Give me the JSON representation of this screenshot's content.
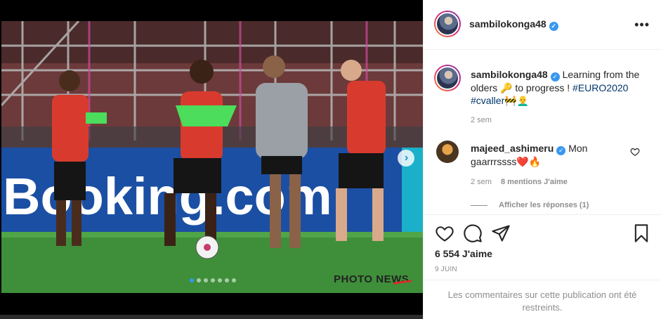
{
  "post": {
    "username": "sambilokonga48",
    "verified_mark": "✓",
    "more_icon": "•••",
    "watermark": "PHOTO NEWS",
    "next_arrow": "›",
    "carousel_dots": 7,
    "active_dot": 0
  },
  "caption": {
    "username": "sambilokonga48",
    "text": "Learning from the olders 🔑 to progress !",
    "hashtag1": "#EURO2020",
    "hashtag2": "#cvaller",
    "emoji_tail": "🚧👨‍🦲",
    "time": "2 sem"
  },
  "comment": {
    "username": "majeed_ashimeru",
    "text": "Mon gaarrrssss❤️🔥",
    "time": "2 sem",
    "likes": "8 mentions J'aime",
    "view_replies": "Afficher les réponses (1)"
  },
  "footer": {
    "likes": "6 554 J'aime",
    "date": "9 JUIN",
    "restricted_notice": "Les commentaires sur cette publication ont été restreints."
  },
  "colors": {
    "link": "#00376b",
    "verified": "#3897f0",
    "muted": "#8e8e8e",
    "pitch": "#3f8f3a",
    "board": "#1b4fa3"
  }
}
